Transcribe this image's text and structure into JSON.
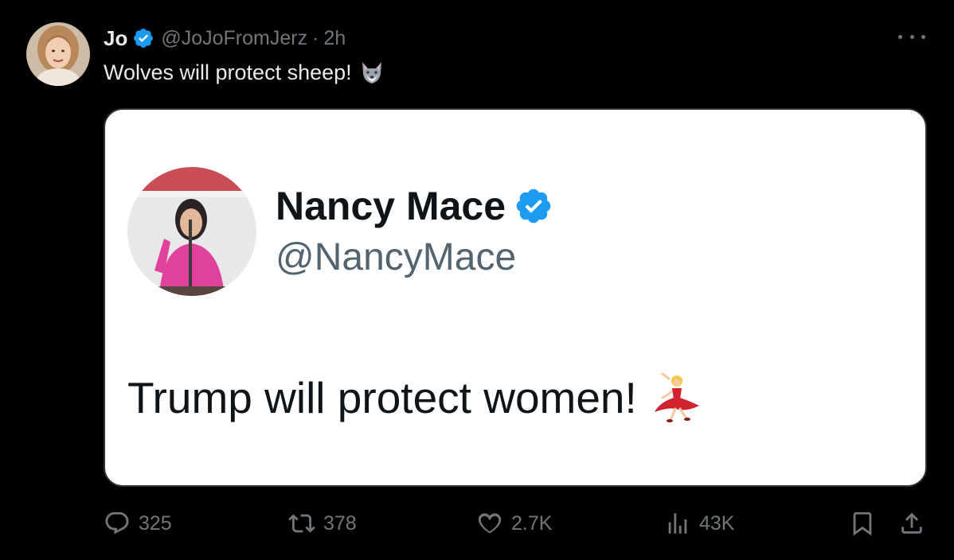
{
  "post": {
    "author": {
      "display_name": "Jo",
      "handle": "@JoJoFromJerz",
      "separator": "·",
      "time": "2h",
      "verified": true
    },
    "text": "Wolves will protect sheep!",
    "text_emoji": "wolf-emoji",
    "more_icon": "more-horizontal-icon"
  },
  "quoted_image": {
    "display_name": "Nancy Mace",
    "handle": "@NancyMace",
    "verified": true,
    "text": "Trump will protect women!",
    "text_emoji": "dancing-woman-emoji"
  },
  "actions": {
    "reply": {
      "icon": "reply-icon",
      "count": "325"
    },
    "repost": {
      "icon": "repost-icon",
      "count": "378"
    },
    "like": {
      "icon": "heart-icon",
      "count": "2.7K"
    },
    "views": {
      "icon": "views-icon",
      "count": "43K"
    },
    "bookmark": {
      "icon": "bookmark-icon"
    },
    "share": {
      "icon": "share-icon"
    }
  },
  "colors": {
    "background": "#000000",
    "primary_text": "#e7e9ea",
    "secondary_text": "#71767b",
    "verified_blue": "#1d9bf0",
    "card_background": "#ffffff",
    "card_text": "#0f1419",
    "card_handle": "#536471"
  }
}
